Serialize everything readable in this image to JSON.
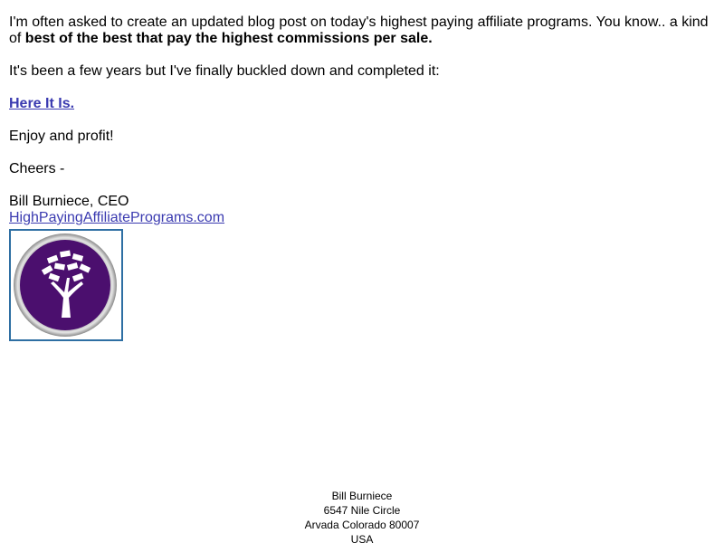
{
  "message": {
    "intro_text": "I'm often asked to create an updated blog post on today's highest paying affiliate programs. You know.. a kind of ",
    "intro_bold": "best of the best that pay the highest commissions per sale.",
    "progress_text": "It's been a few years but I've finally buckled down and completed it:",
    "link_label": "Here It Is.",
    "enjoy_text": "Enjoy and profit!",
    "cheers_text": "Cheers -",
    "signature_name": "Bill Burniece, CEO",
    "website_link": "HighPayingAffiliatePrograms.com"
  },
  "logo": {
    "icon": "money-tree-icon",
    "purple": "#4b0f6e",
    "ring": "#c8c8c8",
    "border": "#2e6fa3"
  },
  "footer": {
    "name": "Bill Burniece",
    "street": "6547 Nile Circle",
    "city": "Arvada Colorado 80007",
    "country": "USA"
  },
  "colors": {
    "link": "#3a3ab0",
    "text": "#000000",
    "background": "#ffffff"
  }
}
